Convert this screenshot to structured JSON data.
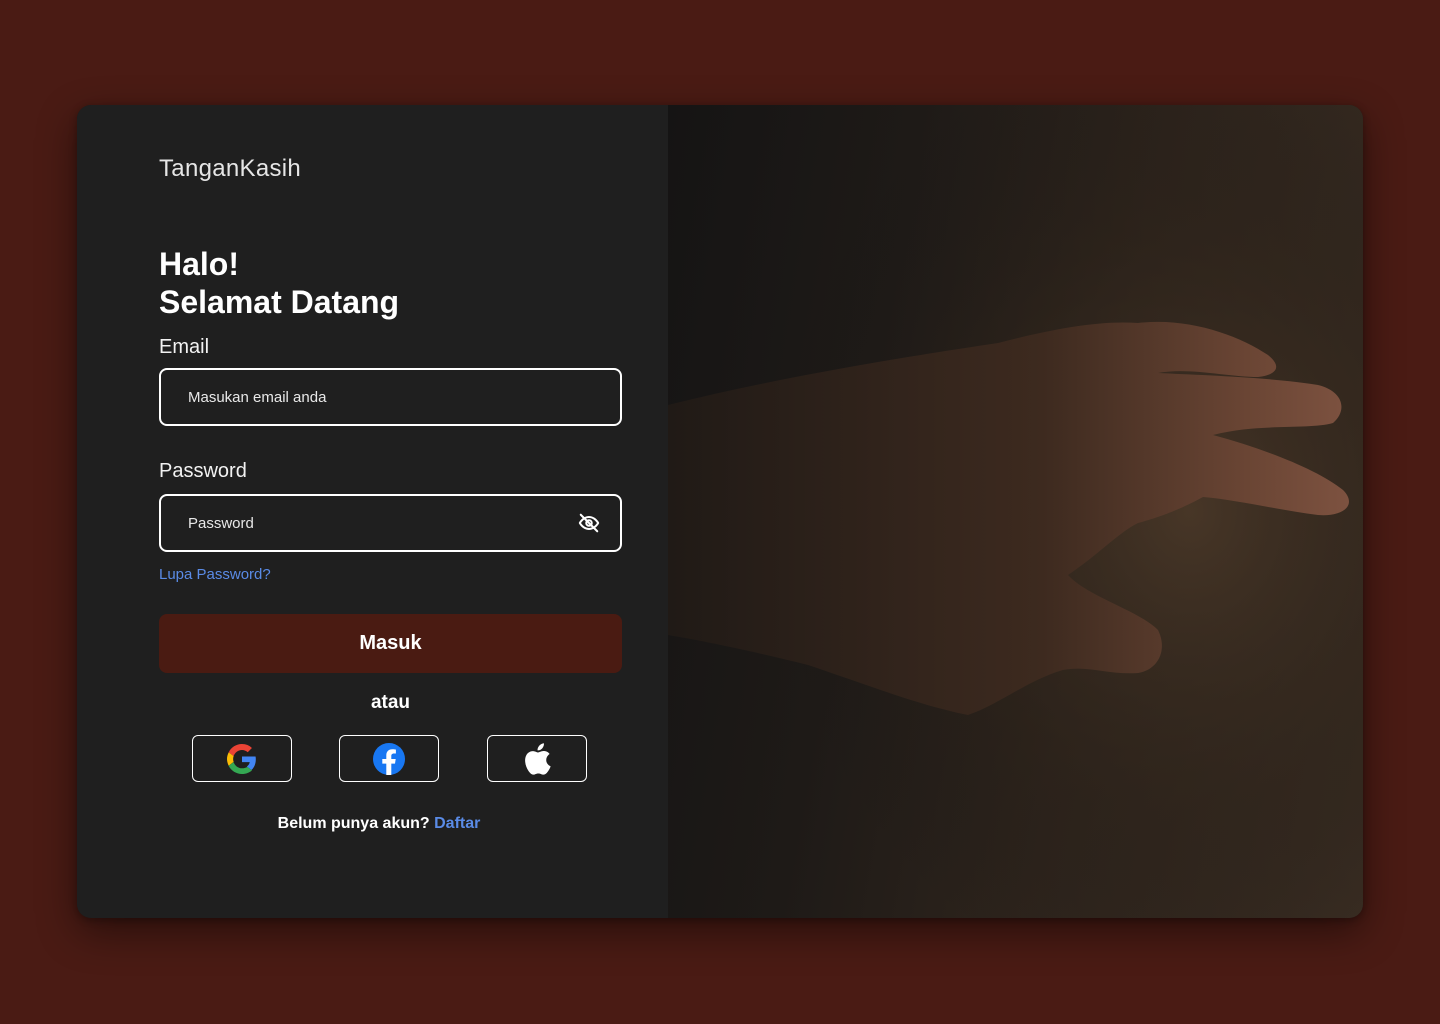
{
  "brand": "TanganKasih",
  "greeting": {
    "line1": "Halo!",
    "line2": "Selamat Datang"
  },
  "email": {
    "label": "Email",
    "placeholder": "Masukan email anda",
    "value": ""
  },
  "password": {
    "label": "Password",
    "placeholder": "Password",
    "value": "",
    "toggle_icon": "eye-off-icon"
  },
  "forgot_password": "Lupa Password?",
  "login_button": "Masuk",
  "divider": "atau",
  "social_logins": [
    {
      "name": "google",
      "icon": "google-icon"
    },
    {
      "name": "facebook",
      "icon": "facebook-icon"
    },
    {
      "name": "apple",
      "icon": "apple-icon"
    }
  ],
  "signup": {
    "prompt": "Belum punya akun?",
    "link": "Daftar"
  },
  "colors": {
    "background": "#4a1b14",
    "card": "#1f1f1f",
    "accent": "#4a1b12",
    "link": "#5a8be6"
  },
  "hero_image": "hand-reaching-photo"
}
